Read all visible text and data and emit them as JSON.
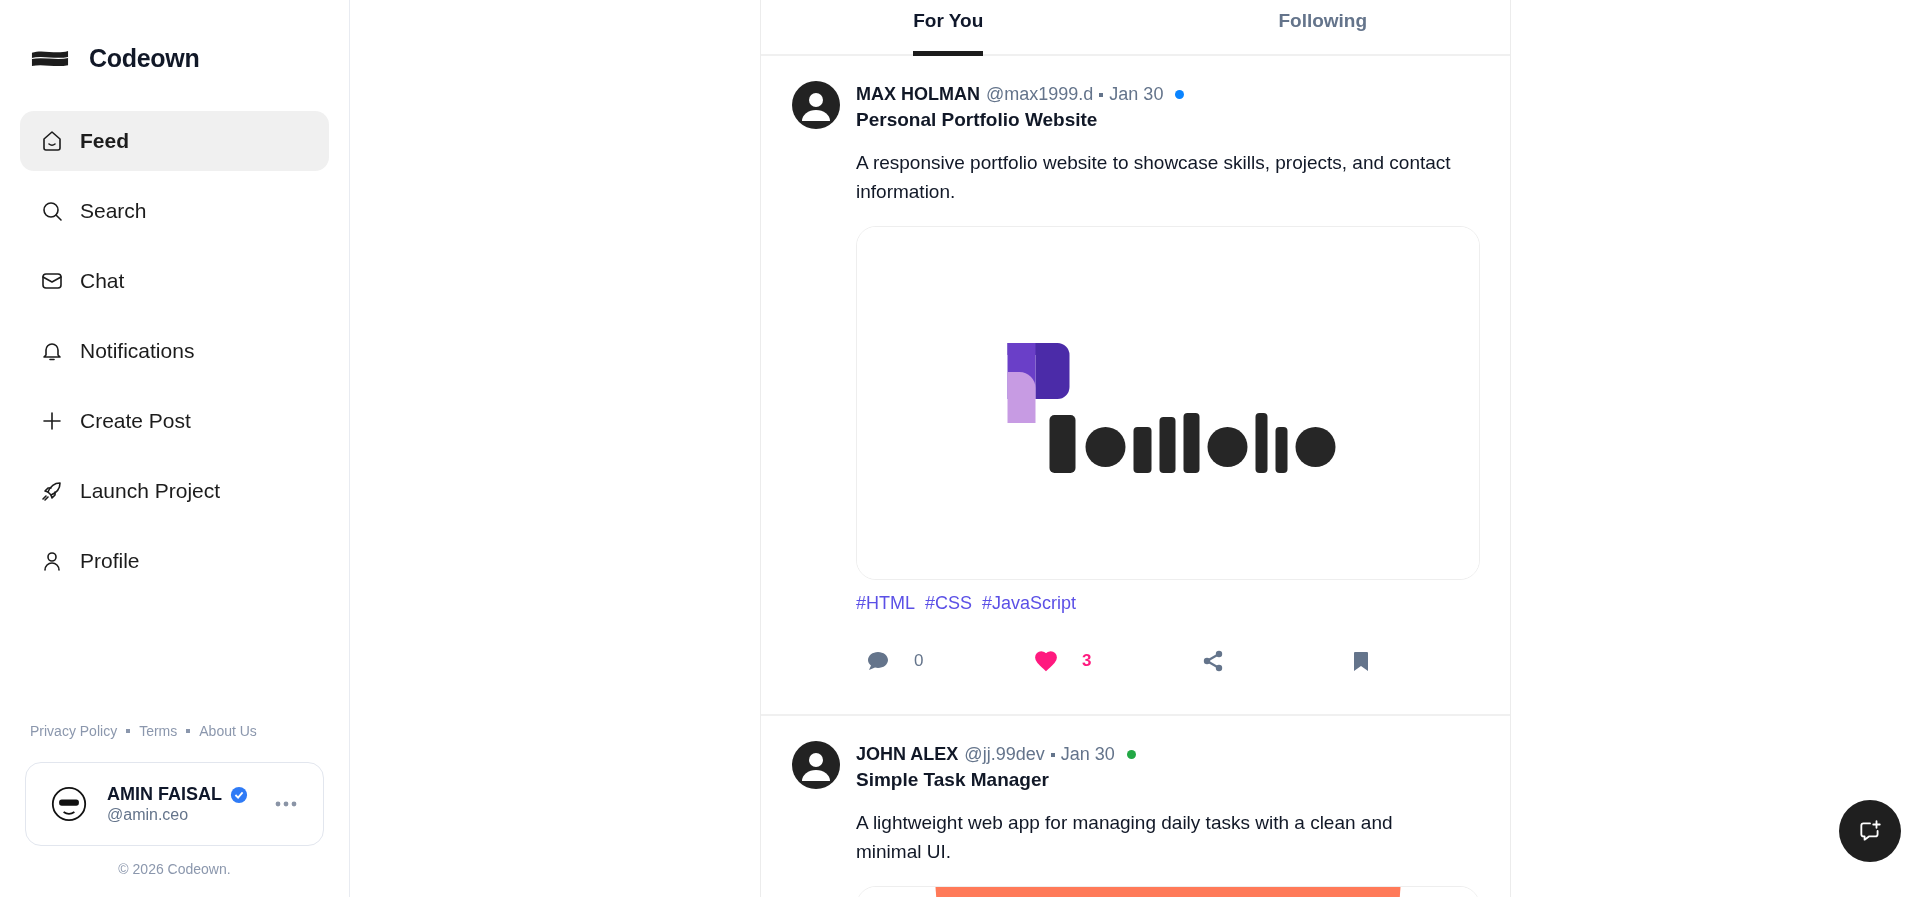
{
  "brand": {
    "name": "Codeown"
  },
  "nav": [
    {
      "label": "Feed",
      "selected": true
    },
    {
      "label": "Search",
      "selected": false
    },
    {
      "label": "Chat",
      "selected": false
    },
    {
      "label": "Notifications",
      "selected": false
    },
    {
      "label": "Create Post",
      "selected": false
    },
    {
      "label": "Launch Project",
      "selected": false
    },
    {
      "label": "Profile",
      "selected": false
    }
  ],
  "footer_links": [
    "Privacy Policy",
    "Terms",
    "About Us"
  ],
  "user": {
    "name": "AMIN FAISAL",
    "handle": "@amin.ceo",
    "verified": true
  },
  "copyright": "© 2026 Codeown.",
  "tabs": [
    {
      "label": "For You",
      "selected": true
    },
    {
      "label": "Following",
      "selected": false
    }
  ],
  "posts": [
    {
      "author": "MAX HOLMAN",
      "handle": "@max1999.d",
      "date": "Jan 30",
      "color": "#0a84ff",
      "title": "Personal Portfolio Website",
      "description": "A responsive portfolio website to showcase skills, projects, and contact information.",
      "tags": [
        "#HTML",
        "#CSS",
        "#JavaScript"
      ],
      "comments": "0",
      "likes": "3",
      "liked": true
    },
    {
      "author": "JOHN ALEX",
      "handle": "@jj.99dev",
      "date": "Jan 30",
      "color": "#22a845",
      "title": "Simple Task Manager",
      "description": "A lightweight web app for managing daily tasks with a clean and minimal UI."
    }
  ]
}
